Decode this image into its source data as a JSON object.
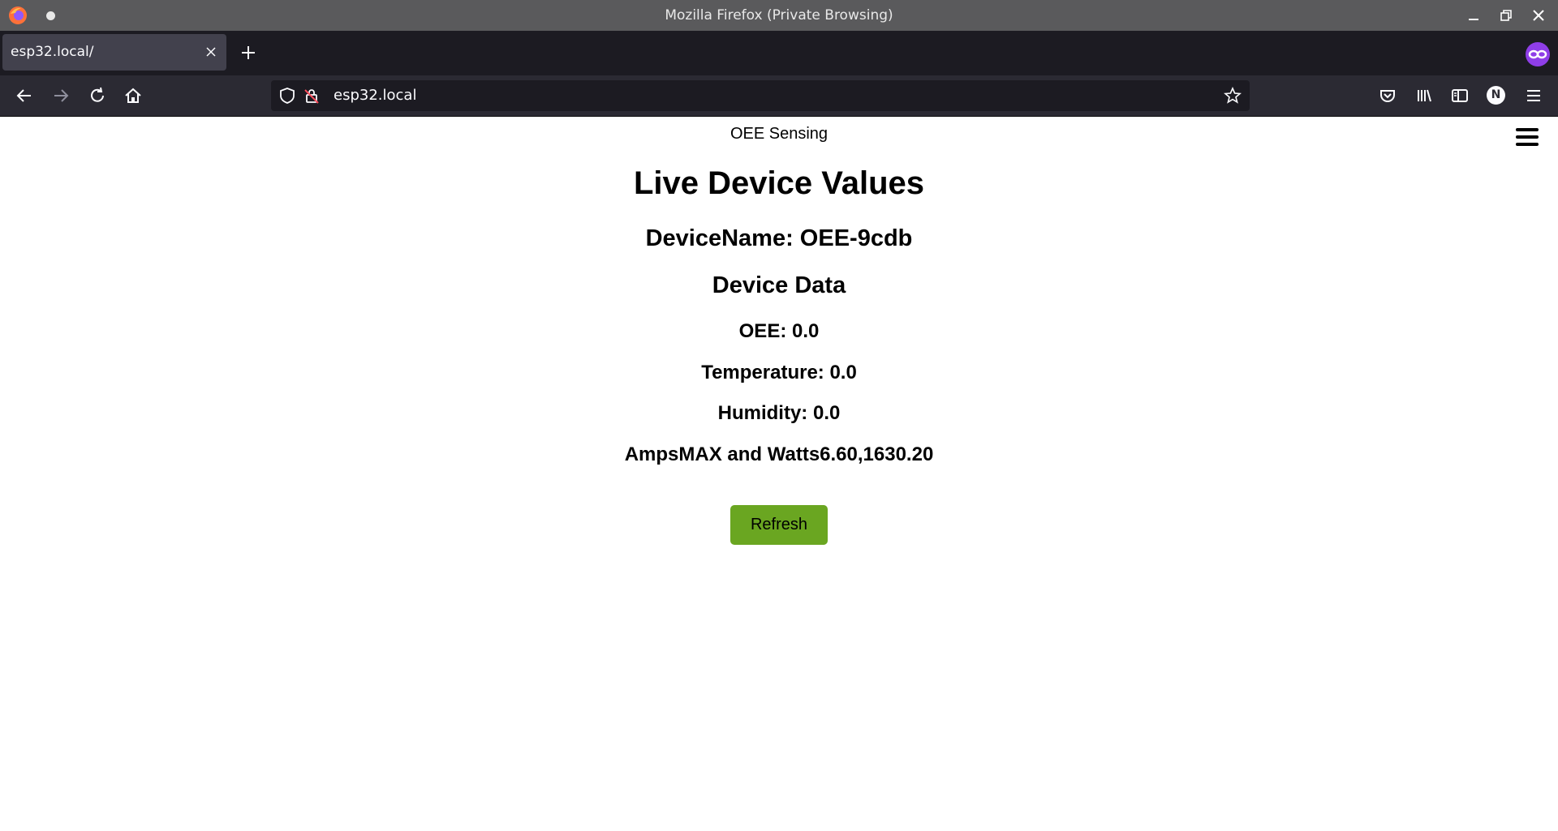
{
  "window": {
    "title": "Mozilla Firefox (Private Browsing)"
  },
  "tabs": [
    {
      "label": "esp32.local/"
    }
  ],
  "urlbar": {
    "url": "esp32.local"
  },
  "profile": {
    "initial": "N"
  },
  "page": {
    "site_name": "OEE Sensing",
    "heading": "Live Device Values",
    "device_name": "DeviceName: OEE-9cdb",
    "section_title": "Device Data",
    "metrics": [
      {
        "text": "OEE: 0.0"
      },
      {
        "text": "Temperature: 0.0"
      },
      {
        "text": "Humidity: 0.0"
      },
      {
        "text": "AmpsMAX and Watts6.60,1630.20"
      }
    ],
    "refresh_label": "Refresh"
  },
  "colors": {
    "refresh_button": "#6aa621",
    "private_badge": "#8f3ee8"
  }
}
